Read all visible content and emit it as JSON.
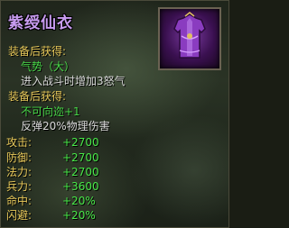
{
  "item": {
    "name": "紫绶仙衣",
    "icon": "purple-robe-icon",
    "name_color": "#c89cf0"
  },
  "equip_bonus_1": {
    "header": "装备后获得:",
    "lines": [
      "气势（大）",
      "进入战斗时增加3怒气"
    ]
  },
  "equip_bonus_2": {
    "header": "装备后获得:",
    "lines": [
      "不可向迩+1",
      "反弹20%物理伤害"
    ]
  },
  "stats": [
    {
      "label": "攻击:",
      "value": "+2700"
    },
    {
      "label": "防御:",
      "value": "+2700"
    },
    {
      "label": "法力:",
      "value": "+2700"
    },
    {
      "label": "兵力:",
      "value": "+3600"
    },
    {
      "label": "命中:",
      "value": "+20%"
    },
    {
      "label": "闪避:",
      "value": "+20%"
    }
  ]
}
